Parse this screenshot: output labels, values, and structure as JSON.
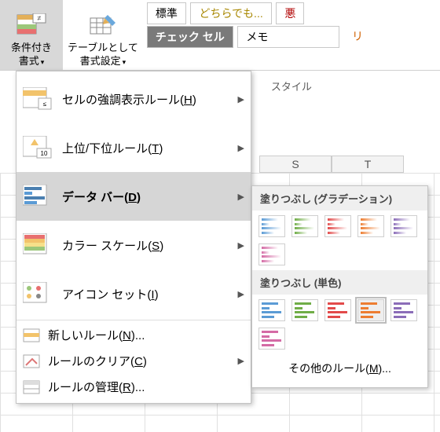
{
  "ribbon": {
    "cond_format": "条件付き\n書式",
    "table_format": "テーブルとして\n書式設定",
    "styles_label": "スタイル",
    "styles": {
      "normal": "標準",
      "either": "どちらでも...",
      "bad": "悪",
      "check": "チェック セル",
      "memo": "メモ",
      "link": "リ"
    }
  },
  "cols": {
    "s": "S",
    "t": "T"
  },
  "menu": {
    "highlight": "セルの強調表示ルール",
    "highlight_k": "H",
    "toprank": "上位/下位ルール",
    "toprank_k": "T",
    "databar": "データ バー",
    "databar_k": "D",
    "colorscale": "カラー スケール",
    "colorscale_k": "S",
    "iconset": "アイコン セット",
    "iconset_k": "I",
    "newrule": "新しいルール",
    "newrule_k": "N",
    "clear": "ルールのクリア",
    "clear_k": "C",
    "manage": "ルールの管理",
    "manage_k": "R"
  },
  "submenu": {
    "grad_head": "塗りつぶし (グラデーション)",
    "solid_head": "塗りつぶし (単色)",
    "more": "その他のルール",
    "more_k": "M",
    "grad_colors": [
      "#5b9bd5",
      "#70ad47",
      "#e24a4a",
      "#ed7d31",
      "#8b6db8",
      "#d46ba5"
    ],
    "solid_colors": [
      "#5b9bd5",
      "#70ad47",
      "#e24a4a",
      "#ed7d31",
      "#8b6db8",
      "#d46ba5"
    ],
    "solid_selected": 3
  }
}
